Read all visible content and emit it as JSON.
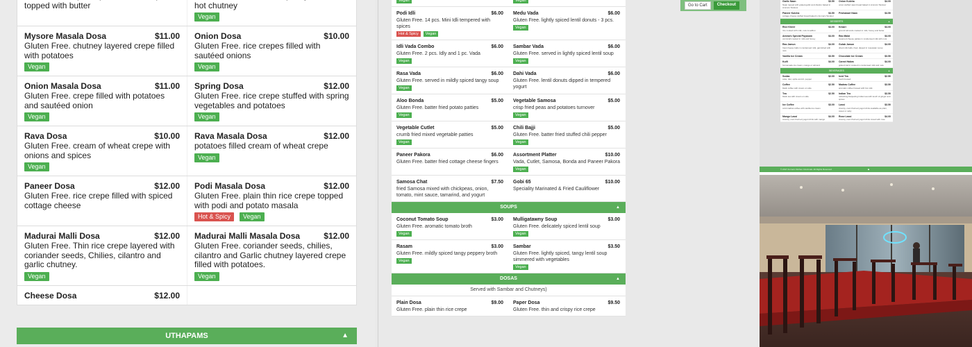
{
  "left_panel": {
    "rows": [
      [
        {
          "name": "",
          "price": "",
          "desc": "Gluten Free. spiced potato filled crepe topped with butter",
          "tags": []
        },
        {
          "name": "",
          "price": "",
          "desc": "Gluten Free. thin rice crepe layered with hot chutney",
          "tags": [
            "Vegan"
          ]
        }
      ],
      [
        {
          "name": "Mysore Masala Dosa",
          "price": "$11.00",
          "desc": "Gluten Free. chutney layered crepe filled with potatoes",
          "tags": [
            "Vegan"
          ]
        },
        {
          "name": "Onion Dosa",
          "price": "$10.00",
          "desc": "Gluten Free. rice crepes filled with sautéed onions",
          "tags": [
            "Vegan"
          ]
        }
      ],
      [
        {
          "name": "Onion Masala Dosa",
          "price": "$11.00",
          "desc": "Gluten Free. crepe filled with potatoes and sautéed onion",
          "tags": [
            "Vegan"
          ]
        },
        {
          "name": "Spring Dosa",
          "price": "$12.00",
          "desc": "Gluten Free. rice crepe stuffed with spring vegetables and potatoes",
          "tags": [
            "Vegan"
          ]
        }
      ],
      [
        {
          "name": "Rava Dosa",
          "price": "$10.00",
          "desc": "Gluten Free. cream of wheat crepe with onions and spices",
          "tags": [
            "Vegan"
          ]
        },
        {
          "name": "Rava Masala Dosa",
          "price": "$12.00",
          "desc": "potatoes filled cream of wheat crepe",
          "tags": [
            "Vegan"
          ]
        }
      ],
      [
        {
          "name": "Paneer Dosa",
          "price": "$12.00",
          "desc": "Gluten Free. rice crepe filled with spiced cottage cheese",
          "tags": []
        },
        {
          "name": "Podi Masala Dosa",
          "price": "$12.00",
          "desc": "Gluten Free. plain thin rice crepe topped with podi and potato masala",
          "tags": [
            "Hot & Spicy",
            "Vegan"
          ]
        }
      ],
      [
        {
          "name": "Madurai Malli Dosa",
          "price": "$12.00",
          "desc": "Gluten Free. Thin rice crepe layered with coriander seeds, Chilies, cilantro and garlic chutney.",
          "tags": [
            "Vegan"
          ]
        },
        {
          "name": "Madurai Malli Masala Dosa",
          "price": "$12.00",
          "desc": "Gluten Free. coriander seeds, chilies, cilantro and Garlic chutney layered crepe filled with potatoes.",
          "tags": [
            "Vegan"
          ]
        }
      ],
      [
        {
          "name": "Cheese Dosa",
          "price": "$12.00",
          "desc": "",
          "tags": []
        },
        {
          "name": "",
          "price": "",
          "desc": "",
          "tags": []
        }
      ]
    ],
    "section": "UTHAPAMS"
  },
  "middle_panel": {
    "rows_top": [
      [
        {
          "name": "",
          "price": "",
          "desc": "",
          "tags": [
            "Vegan"
          ]
        },
        {
          "name": "",
          "price": "",
          "desc": "",
          "tags": [
            "Vegan"
          ]
        }
      ],
      [
        {
          "name": "Podi Idli",
          "price": "$6.00",
          "desc": "Gluten Free. 14 pcs. Mini Idli tempered with spices",
          "tags": [
            "Hot & Spicy",
            "Vegan"
          ]
        },
        {
          "name": "Medu Vada",
          "price": "$6.00",
          "desc": "Gluten Free. lightly spiced lentil donuts - 3 pcs.",
          "tags": [
            "Vegan"
          ]
        }
      ],
      [
        {
          "name": "Idli Vada Combo",
          "price": "$6.00",
          "desc": "Gluten Free. 2 pcs. Idly and 1 pc. Vada",
          "tags": [
            "Vegan"
          ]
        },
        {
          "name": "Sambar Vada",
          "price": "$6.00",
          "desc": "Gluten Free. served in lightly spiced lentil soup",
          "tags": [
            "Vegan"
          ]
        }
      ],
      [
        {
          "name": "Rasa Vada",
          "price": "$6.00",
          "desc": "Gluten Free. served in mildly spiced tangy soup",
          "tags": [
            "Vegan"
          ]
        },
        {
          "name": "Dahi Vada",
          "price": "$6.00",
          "desc": "Gluten Free. lentil donuts dipped in tempered yogurt",
          "tags": []
        }
      ],
      [
        {
          "name": "Aloo Bonda",
          "price": "$5.00",
          "desc": "Gluten Free. batter fried potato patties",
          "tags": [
            "Vegan"
          ]
        },
        {
          "name": "Vegetable Samosa",
          "price": "$5.00",
          "desc": "crisp fried peas and potatoes turnover",
          "tags": [
            "Vegan"
          ]
        }
      ],
      [
        {
          "name": "Vegetable Cutlet",
          "price": "$5.00",
          "desc": "crumb fried mixed vegetable patties",
          "tags": [
            "Vegan"
          ]
        },
        {
          "name": "Chili Bajji",
          "price": "$5.00",
          "desc": "Gluten Free. batter fried stuffed chili pepper",
          "tags": [
            "Vegan"
          ]
        }
      ],
      [
        {
          "name": "Paneer Pakora",
          "price": "$6.00",
          "desc": "Gluten Free. batter fried cottage cheese fingers",
          "tags": []
        },
        {
          "name": "Assortment Platter",
          "price": "$10.00",
          "desc": "Vada, Cutlet, Samosa, Bonda and Paneer Pakora",
          "tags": [
            "Vegan"
          ]
        }
      ],
      [
        {
          "name": "Samosa Chat",
          "price": "$7.50",
          "desc": "fried Samosa mixed with chickpeas, onion, tomato, mint sauce, tamarind, and yogurt",
          "tags": []
        },
        {
          "name": "Gobi 65",
          "price": "$10.00",
          "desc": "Speciality Marinated & Fried Cauliflower",
          "tags": []
        }
      ]
    ],
    "soups_label": "SOUPS",
    "rows_soups": [
      [
        {
          "name": "Coconut Tomato Soup",
          "price": "$3.00",
          "desc": "Gluten Free. aromatic tomato broth",
          "tags": [
            "Vegan"
          ]
        },
        {
          "name": "Mulligatawny Soup",
          "price": "$3.00",
          "desc": "Gluten Free. delicately spiced lentil soup",
          "tags": [
            "Vegan"
          ]
        }
      ],
      [
        {
          "name": "Rasam",
          "price": "$3.00",
          "desc": "Gluten Free. mildly spiced tangy peppery broth",
          "tags": [
            "Vegan"
          ]
        },
        {
          "name": "Sambar",
          "price": "$3.50",
          "desc": "Gluten Free. lightly spiced, tangy lentil soup simmered with vegetables",
          "tags": [
            "Vegan"
          ]
        }
      ]
    ],
    "dosas_label": "DOSAS",
    "dosas_sub": "Served with Sambar and Chutneys)",
    "rows_dosas": [
      [
        {
          "name": "Plain Dosa",
          "price": "$9.00",
          "desc": "Gluten Free. plain thin rice crepe",
          "tags": []
        },
        {
          "name": "Paper Dosa",
          "price": "$9.50",
          "desc": "Gluten Free. thin and crispy rice crepe",
          "tags": []
        }
      ]
    ],
    "go_to_cart": "Go to Cart",
    "checkout": "Checkout"
  },
  "right_panel": {
    "rows_a": [
      [
        {
          "name": "Garlic Naan",
          "price": "$3.50",
          "desc": "Naan topped with grated garlic and cilantro baked in Amma's Tandoor"
        },
        {
          "name": "Onion Kulcha",
          "price": "$4.00",
          "desc": "onion stuffed naan bread baked in Amma's Tandoor"
        }
      ],
      [
        {
          "name": "Paneer Kulcha",
          "price": "$4.50",
          "desc": "cottage cheese stuffed bread baked in Amma's Tandoor"
        },
        {
          "name": "Peshawari Naan",
          "price": "$4.50",
          "desc": ""
        }
      ]
    ],
    "desserts_label": "DESSERTS",
    "rows_b": [
      [
        {
          "name": "Rice Kheer",
          "price": "$4.00",
          "desc": "rice cooked with milk, nuts & saffron"
        },
        {
          "name": "Kesari",
          "price": "$4.00",
          "desc": "ground almonds cooked in milk, honey and butter"
        }
      ],
      [
        {
          "name": "Amma's Special Payasam",
          "price": "$4.00",
          "desc": "vermicelli cooked in milk and honey"
        },
        {
          "name": "Ras Malai",
          "price": "$4.00",
          "desc": "steamed cheese patties in condensed milk with nuts"
        }
      ],
      [
        {
          "name": "Ras Jamun",
          "price": "$4.00",
          "desc": "fried cheese balls in condensed milk, garnished with nuts"
        },
        {
          "name": "Gulab Jamun",
          "price": "$4.00",
          "desc": "dried milk balls, fried, dipped in rosewater syrup"
        }
      ],
      [
        {
          "name": "Vanilla Ice Cream",
          "price": "$3.50",
          "desc": ""
        },
        {
          "name": "Chocolate Ice Cream",
          "price": "$3.50",
          "desc": ""
        }
      ],
      [
        {
          "name": "Kulfi",
          "price": "$4.00",
          "desc": "homemade ice cream, mango or almond"
        },
        {
          "name": "Carrot Halwa",
          "price": "$4.00",
          "desc": "grated carrot cooked in condensed milk and nuts"
        }
      ]
    ],
    "beverages_label": "BEVERAGES",
    "rows_c": [
      [
        {
          "name": "Sodas",
          "price": "$2.00",
          "desc": "coke, diet, sprite and dr. pepper"
        },
        {
          "name": "Iced Tea",
          "price": "$2.50",
          "desc": "fresh brewed"
        }
      ],
      [
        {
          "name": "Coffee",
          "price": "$2.50",
          "desc": "black coffee with cream on side"
        },
        {
          "name": "Madras Coffee",
          "price": "$3.50",
          "desc": "aromatic coffee brewed with hot milk"
        }
      ],
      [
        {
          "name": "Tea",
          "price": "$2.50",
          "desc": "black tea with cream on side"
        },
        {
          "name": "Indian Tea",
          "price": "$3.50",
          "desc": "refreshing Darjeeling Indian tea with touch of ginger and spices"
        }
      ],
      [
        {
          "name": "Ice Coffee",
          "price": "$3.00",
          "desc": "cold madras coffee with vanilla ice cream"
        },
        {
          "name": "Lassi",
          "price": "$3.50",
          "desc": "creamy, cool churned yogurt drink available as plain, sweet or salty"
        }
      ],
      [
        {
          "name": "Mango Lassi",
          "price": "$4.00",
          "desc": "creamy, cool churned yogurt drink with mango"
        },
        {
          "name": "Rose Lassi",
          "price": "$4.00",
          "desc": "creamy, cool churned yogurt drink mixed with rose"
        }
      ]
    ],
    "footer": "© 2017 Amma's Kitchen Cincinnati. All Rights Reserved"
  },
  "colors": {
    "section_green": "#5aae5a",
    "vegan_green": "#4caf50",
    "hot_red": "#d9534f"
  }
}
